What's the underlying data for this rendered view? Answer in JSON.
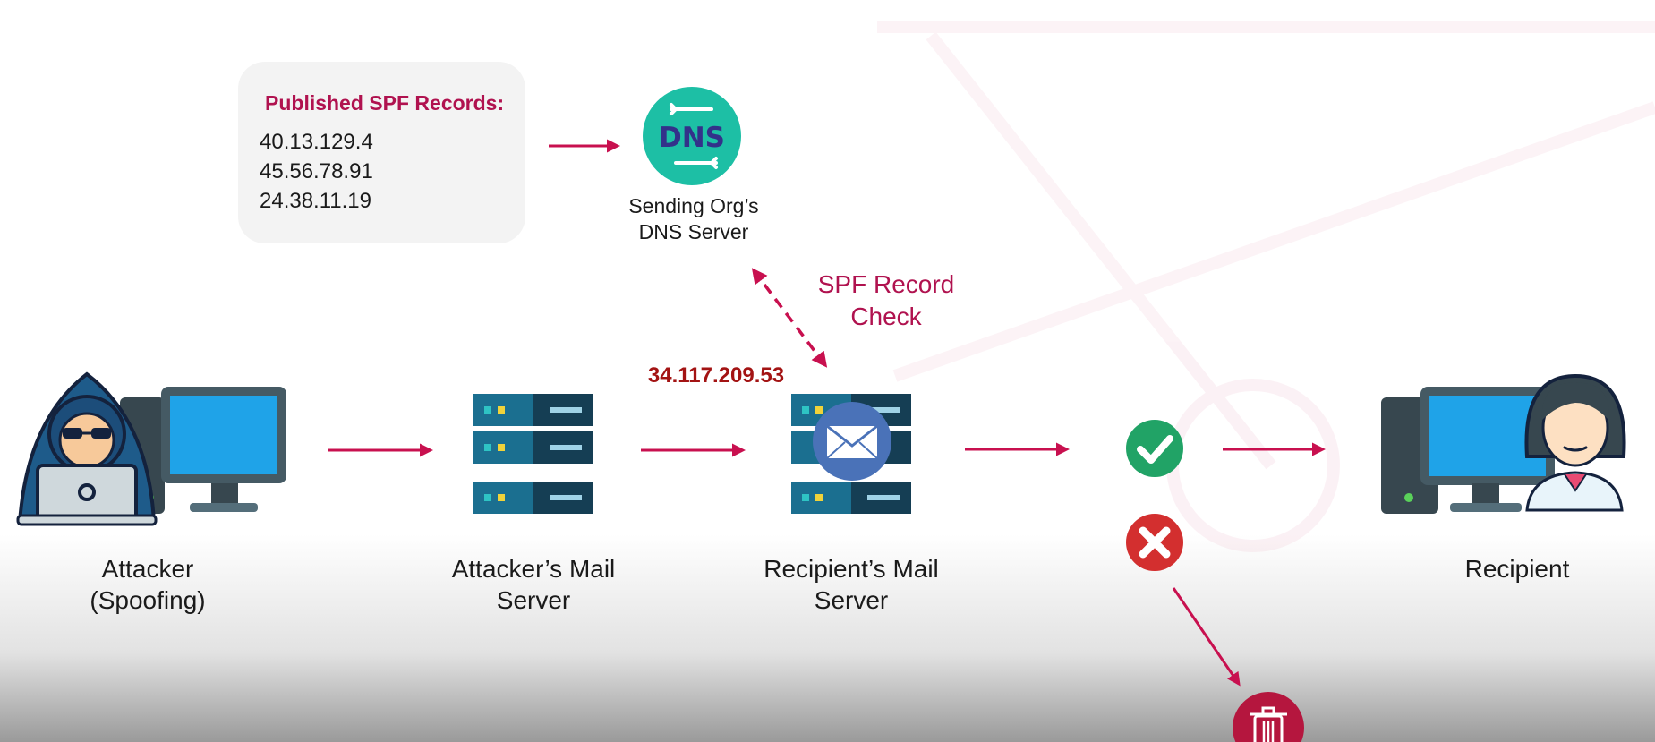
{
  "spf_records": {
    "title": "Published SPF Records:",
    "ips": [
      "40.13.129.4",
      "45.56.78.91",
      "24.38.11.19"
    ]
  },
  "dns_server": {
    "label_line1": "Sending Org’s",
    "label_line2": "DNS Server",
    "icon": "dns-icon"
  },
  "spf_check": {
    "label_line1": "SPF Record",
    "label_line2": "Check"
  },
  "sender_ip": "34.117.209.53",
  "nodes": {
    "attacker": {
      "line1": "Attacker",
      "line2": "(Spoofing)",
      "icon": "hacker-computer-icon"
    },
    "attacker_mail": {
      "line1": "Attacker’s Mail",
      "line2": "Server",
      "icon": "server-icon"
    },
    "recipient_mail": {
      "line1": "Recipient’s Mail",
      "line2": "Server",
      "icon": "mail-server-icon"
    },
    "recipient": {
      "line1": "Recipient",
      "icon": "user-computer-icon"
    }
  },
  "results": {
    "pass_icon": "check-icon",
    "fail_icon": "x-icon",
    "trash_icon": "trash-icon"
  },
  "colors": {
    "accent": "#c8104f",
    "title_red": "#b0124f",
    "ip_red": "#a31313",
    "check_green": "#21a366",
    "fail_red": "#d32f2f",
    "dns_teal": "#1dbfa5"
  }
}
